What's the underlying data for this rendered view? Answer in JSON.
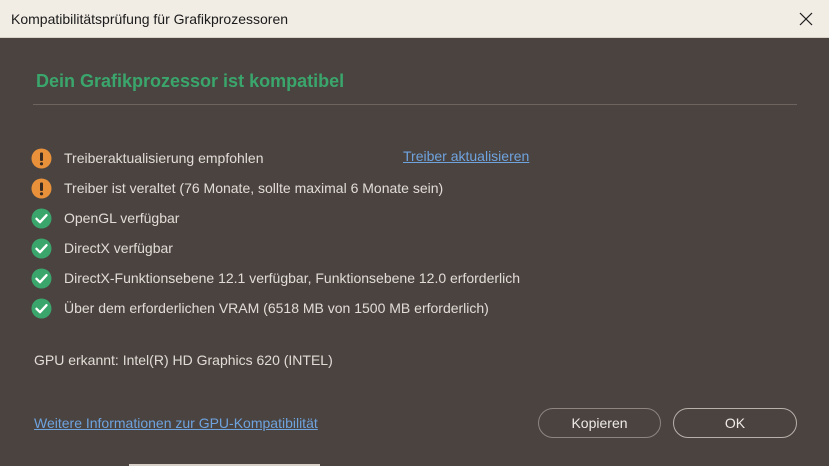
{
  "window": {
    "title": "Kompatibilitätsprüfung für Grafikprozessoren",
    "close_icon": "close-icon"
  },
  "header": {
    "title": "Dein Grafikprozessor ist kompatibel"
  },
  "checks": [
    {
      "status": "warning",
      "icon": "warning-icon",
      "text": "Treiberaktualisierung empfohlen"
    },
    {
      "status": "warning",
      "icon": "warning-icon",
      "text": "Treiber ist veraltet (76 Monate, sollte maximal 6 Monate sein)"
    },
    {
      "status": "ok",
      "icon": "check-icon",
      "text": "OpenGL verfügbar"
    },
    {
      "status": "ok",
      "icon": "check-icon",
      "text": "DirectX verfügbar"
    },
    {
      "status": "ok",
      "icon": "check-icon",
      "text": "DirectX-Funktionsebene 12.1 verfügbar, Funktionsebene 12.0 erforderlich"
    },
    {
      "status": "ok",
      "icon": "check-icon",
      "text": "Über dem erforderlichen VRAM (6518 MB von 1500 MB erforderlich)"
    }
  ],
  "update_driver_link": "Treiber aktualisieren",
  "gpu_detected": "GPU erkannt: Intel(R) HD Graphics 620 (INTEL)",
  "footer": {
    "info_link": "Weitere Informationen zur GPU-Kompatibilität",
    "copy_label": "Kopieren",
    "ok_label": "OK"
  },
  "colors": {
    "warning": "#e8913a",
    "ok": "#3aa66c",
    "heading": "#3aa66c",
    "link": "#6fa3de",
    "background": "#4a4340",
    "titlebar": "#f1ece4"
  }
}
